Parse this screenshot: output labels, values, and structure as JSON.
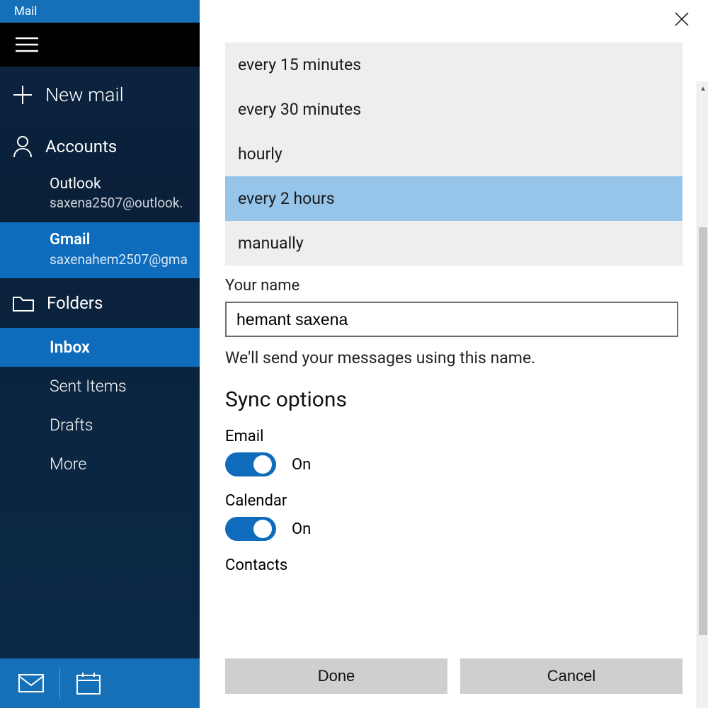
{
  "titlebar": {
    "app_name": "Mail"
  },
  "sidebar": {
    "new_mail": "New mail",
    "accounts_label": "Accounts",
    "accounts": [
      {
        "name": "Outlook",
        "email": "saxena2507@outlook."
      },
      {
        "name": "Gmail",
        "email": "saxenahem2507@gma"
      }
    ],
    "folders_label": "Folders",
    "folders": [
      "Inbox",
      "Sent Items",
      "Drafts",
      "More"
    ]
  },
  "settings": {
    "dropdown_options": [
      "every 15 minutes",
      "every 30 minutes",
      "hourly",
      "every 2 hours",
      "manually"
    ],
    "dropdown_selected_index": 3,
    "your_name_label": "Your name",
    "your_name_value": "hemant saxena",
    "your_name_help": "We'll send your messages using this name.",
    "sync_header": "Sync options",
    "sync": {
      "email": {
        "label": "Email",
        "state": "On"
      },
      "calendar": {
        "label": "Calendar",
        "state": "On"
      },
      "contacts": {
        "label": "Contacts"
      }
    },
    "buttons": {
      "done": "Done",
      "cancel": "Cancel"
    }
  }
}
